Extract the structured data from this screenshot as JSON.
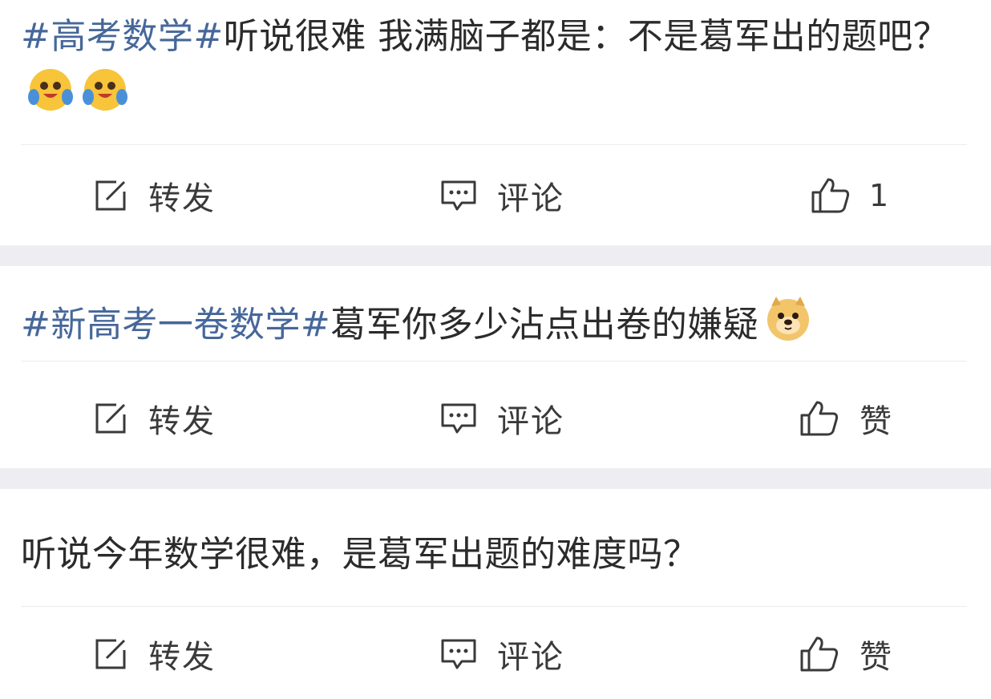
{
  "posts": [
    {
      "topic": "#高考数学#",
      "text": "听说很难 我满脑子都是：不是葛军出的题吧？",
      "emojis": [
        "hug-emoji",
        "hug-emoji"
      ],
      "actions": {
        "repost": "转发",
        "comment": "评论",
        "like": "1"
      }
    },
    {
      "topic": "#新高考一卷数学#",
      "text": "葛军你多少沾点出卷的嫌疑",
      "emojis": [
        "doge-emoji"
      ],
      "actions": {
        "repost": "转发",
        "comment": "评论",
        "like": "赞"
      }
    },
    {
      "topic": "",
      "text": "听说今年数学很难，是葛军出题的难度吗？",
      "emojis": [],
      "actions": {
        "repost": "转发",
        "comment": "评论",
        "like": "赞"
      }
    }
  ],
  "colors": {
    "topic": "#46679a",
    "text": "#2b2b2b",
    "separator": "#eeeef2",
    "emoji_yellow": "#f7c43a"
  }
}
